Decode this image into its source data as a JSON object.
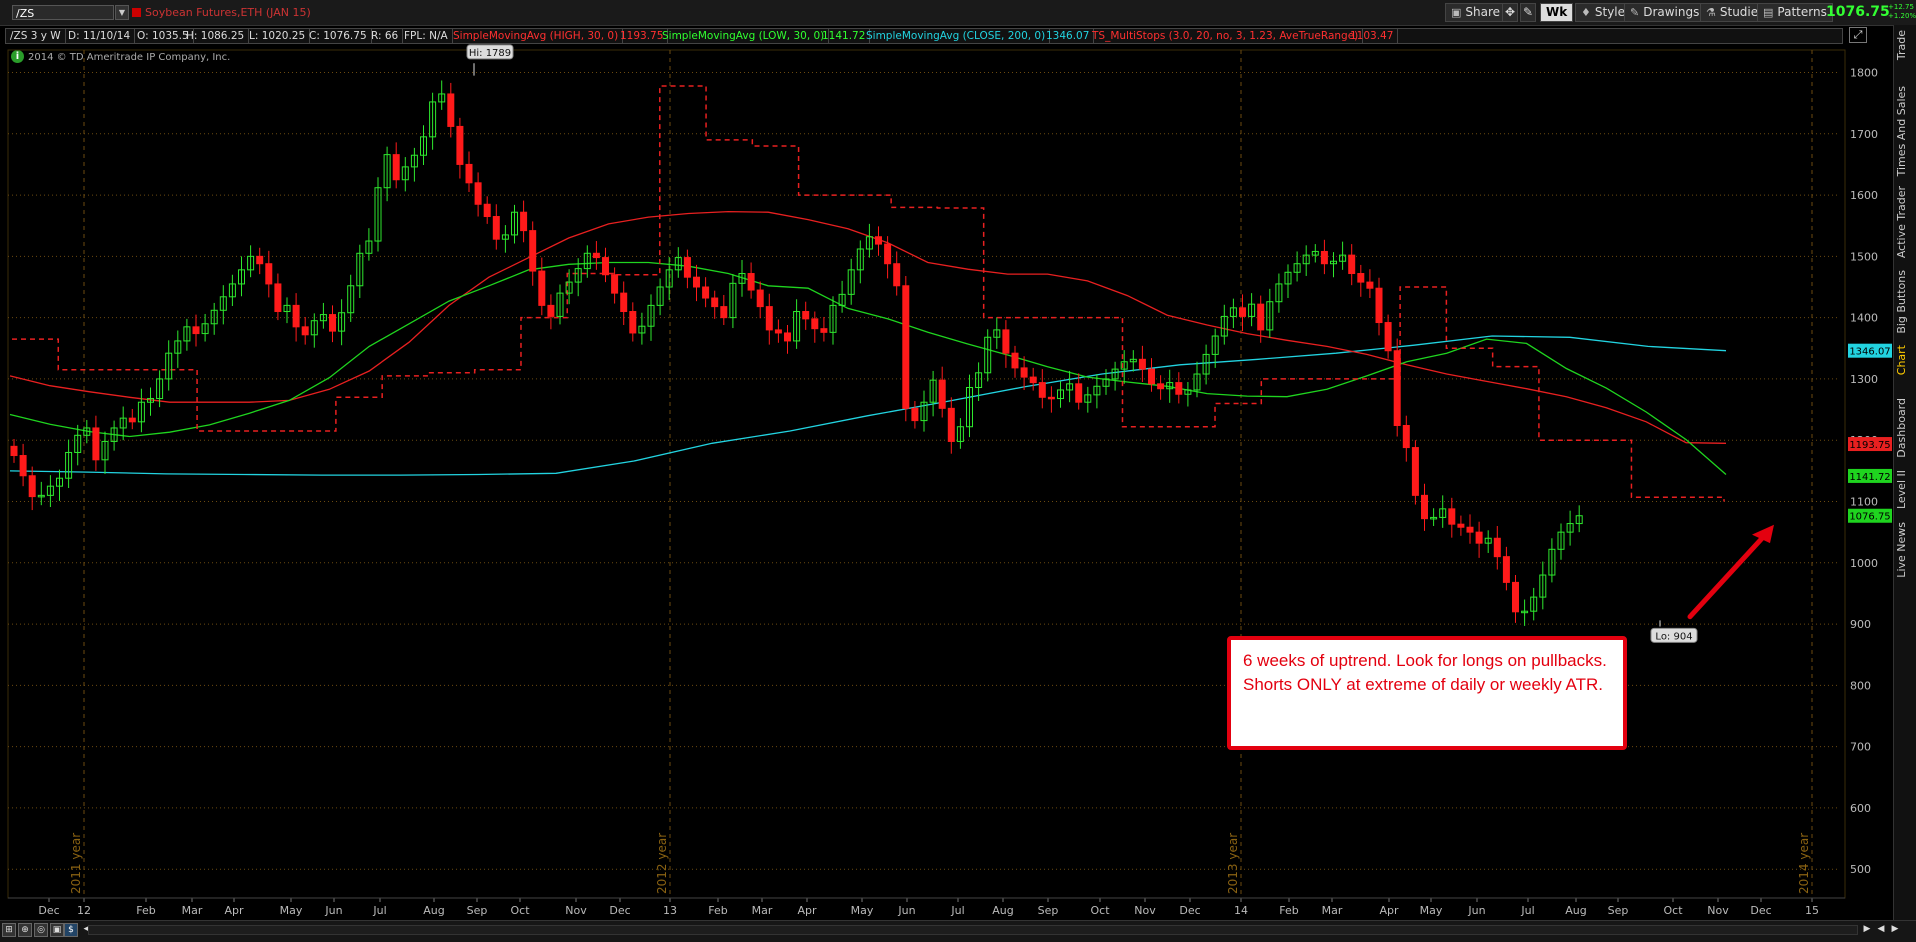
{
  "toolbar": {
    "symbol": "/ZS",
    "description": "Soybean Futures,ETH (JAN 15)",
    "share_label": "Share",
    "wk_label": "Wk",
    "style_label": "Style",
    "drawings_label": "Drawings",
    "studies_label": "Studies",
    "patterns_label": "Patterns",
    "last_price": "1076.75",
    "change_1": "+12.75",
    "change_2": "+1.20%"
  },
  "infobar": {
    "chart_id": "/ZS 3 y W",
    "date": "D: 11/10/14",
    "open": "O: 1035.5",
    "high": "H: 1086.25",
    "low": "L: 1020.25",
    "close": "C: 1076.75",
    "range": "R: 66",
    "fpl": "FPL: N/A",
    "study1": "SimpleMovingAvg (HIGH, 30, 0)",
    "study1_value": "1193.75",
    "study2": "SimpleMovingAvg (LOW, 30, 0)",
    "study2_value": "1141.72",
    "study3": "SimpleMovingAvg (CLOSE, 200, 0)",
    "study3_value": "1346.07",
    "study4": "TS_MultiStops (3.0, 20, no, 3, 1.23, AveTrueRange)",
    "study4_value": "1103.47"
  },
  "copyright": "2014 © TD Ameritrade IP Company, Inc.",
  "info_icon": "i",
  "sidebar_tabs": [
    "Trade",
    "Times And Sales",
    "Active Trader",
    "Big Buttons",
    "Chart",
    "Dashboard",
    "Level II",
    "Live News"
  ],
  "annotation": "6 weeks of uptrend. Look for longs on pullbacks. Shorts ONLY at extreme of daily or weekly ATR.",
  "colors": {
    "up": "#2ee82e",
    "down": "#ff1a1a",
    "sma_high": "#e82020",
    "sma_low": "#1fd41f",
    "sma_close": "#22d3e0",
    "stops": "#e82020",
    "grid": "#6b4a10",
    "annotation": "#e3000f"
  },
  "chart_data": {
    "type": "candlestick",
    "interval": "weekly",
    "ylim": [
      480,
      1830
    ],
    "y_ticks": [
      500,
      600,
      700,
      800,
      900,
      1000,
      1100,
      1200,
      1300,
      1400,
      1500,
      1600,
      1700,
      1800
    ],
    "x_month_labels": [
      "Dec",
      "12",
      "Feb",
      "Mar",
      "Apr",
      "May",
      "Jun",
      "Jul",
      "Aug",
      "Sep",
      "Oct",
      "Nov",
      "Dec",
      "13",
      "Feb",
      "Mar",
      "Apr",
      "May",
      "Jun",
      "Jul",
      "Aug",
      "Sep",
      "Oct",
      "Nov",
      "Dec",
      "14",
      "Feb",
      "Mar",
      "Apr",
      "May",
      "Jun",
      "Jul",
      "Aug",
      "Sep",
      "Oct",
      "Nov",
      "Dec",
      "15"
    ],
    "year_labels": [
      "2011 year",
      "2012 year",
      "2013 year",
      "2014 year"
    ],
    "high_label": "Hi: 1789",
    "low_label": "Lo: 904",
    "hi_value": 1789,
    "lo_value": 904,
    "price_badges": [
      {
        "label": "1346.07",
        "value": 1346.07,
        "color": "#22d3e0"
      },
      {
        "label": "1193.75",
        "value": 1193.75,
        "color": "#e82020"
      },
      {
        "label": "1141.72",
        "value": 1141.72,
        "color": "#1fd41f"
      },
      {
        "label": "1076.75",
        "value": 1076.75,
        "color": "#1fd41f"
      }
    ],
    "closes": [
      1175,
      1142,
      1108,
      1110,
      1125,
      1138,
      1180,
      1208,
      1220,
      1168,
      1198,
      1220,
      1236,
      1230,
      1262,
      1268,
      1300,
      1342,
      1362,
      1385,
      1374,
      1390,
      1412,
      1434,
      1455,
      1478,
      1500,
      1488,
      1455,
      1410,
      1420,
      1385,
      1372,
      1395,
      1405,
      1378,
      1408,
      1452,
      1505,
      1525,
      1612,
      1666,
      1625,
      1646,
      1665,
      1695,
      1752,
      1765,
      1712,
      1650,
      1620,
      1585,
      1565,
      1528,
      1535,
      1572,
      1542,
      1476,
      1420,
      1402,
      1440,
      1458,
      1480,
      1505,
      1498,
      1470,
      1440,
      1410,
      1375,
      1386,
      1420,
      1450,
      1478,
      1498,
      1466,
      1450,
      1432,
      1418,
      1400,
      1456,
      1472,
      1445,
      1418,
      1380,
      1375,
      1362,
      1410,
      1398,
      1382,
      1376,
      1420,
      1438,
      1478,
      1512,
      1532,
      1520,
      1488,
      1452,
      1252,
      1232,
      1262,
      1298,
      1252,
      1198,
      1222,
      1286,
      1310,
      1368,
      1380,
      1342,
      1318,
      1303,
      1294,
      1270,
      1268,
      1282,
      1292,
      1262,
      1274,
      1288,
      1300,
      1316,
      1328,
      1332,
      1316,
      1292,
      1284,
      1294,
      1275,
      1282,
      1308,
      1340,
      1370,
      1402,
      1416,
      1402,
      1422,
      1380,
      1426,
      1455,
      1474,
      1488,
      1502,
      1508,
      1488,
      1492,
      1502,
      1472,
      1458,
      1448,
      1392,
      1346,
      1224,
      1188,
      1110,
      1072,
      1074,
      1088,
      1063,
      1058,
      1050,
      1032,
      1040,
      1010,
      968,
      920,
      921,
      944,
      980,
      1022,
      1050,
      1064,
      1076.75
    ],
    "sma_high_30": [
      1305,
      1289,
      1279,
      1270,
      1262,
      1262,
      1262,
      1265,
      1283,
      1313,
      1360,
      1420,
      1466,
      1498,
      1530,
      1553,
      1564,
      1570,
      1573,
      1572,
      1560,
      1545,
      1522,
      1490,
      1479,
      1471,
      1471,
      1460,
      1436,
      1404,
      1388,
      1374,
      1363,
      1353,
      1340,
      1323,
      1308,
      1296,
      1284,
      1271,
      1253,
      1230,
      1196,
      1195
    ],
    "sma_low_30": [
      1242,
      1226,
      1214,
      1206,
      1213,
      1225,
      1244,
      1265,
      1302,
      1353,
      1390,
      1427,
      1452,
      1478,
      1487,
      1490,
      1490,
      1484,
      1472,
      1452,
      1448,
      1415,
      1398,
      1376,
      1357,
      1339,
      1320,
      1303,
      1295,
      1288,
      1276,
      1272,
      1271,
      1283,
      1305,
      1328,
      1342,
      1365,
      1358,
      1317,
      1285,
      1246,
      1201,
      1144
    ],
    "sma_close_200": [
      1150,
      1148,
      1145,
      1144,
      1143,
      1143,
      1144,
      1146,
      1166,
      1195,
      1215,
      1240,
      1263,
      1287,
      1308,
      1323,
      1332,
      1342,
      1355,
      1370,
      1368,
      1353,
      1346
    ],
    "stops": [
      1365,
      1315,
      1315,
      1315,
      1215,
      1215,
      1215,
      1270,
      1305,
      1310,
      1315,
      1400,
      1472,
      1470,
      1778,
      1690,
      1680,
      1600,
      1600,
      1580,
      1579,
      1400,
      1400,
      1400,
      1222,
      1222,
      1260,
      1300,
      1300,
      1300,
      1450,
      1350,
      1320,
      1200,
      1200,
      1107,
      1107,
      1100
    ]
  }
}
